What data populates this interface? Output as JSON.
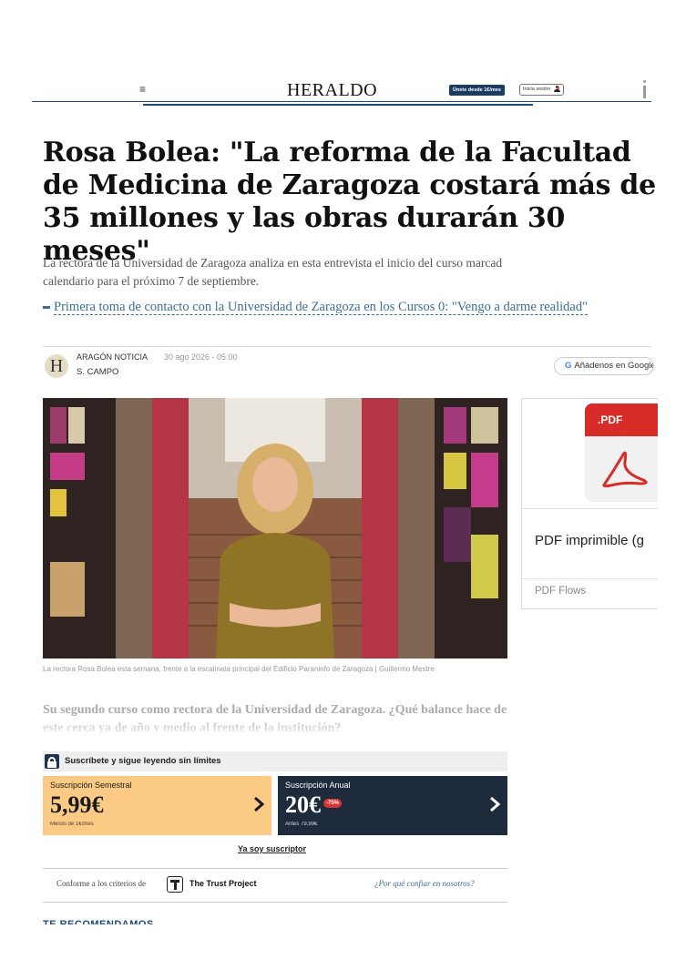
{
  "header": {
    "menu_icon": "hamburger-icon",
    "logo": "HERALDO",
    "join_button": "Únete desde 1€/mes",
    "login_button": "Inicia sesión",
    "login_icon": "user-icon"
  },
  "article": {
    "headline": "Rosa Bolea: \"La reforma de la Facultad de Medicina de Zaragoza costará más de 35 millones y las obras durarán 30 meses\"",
    "subtitle_line1": "La rectora de la Universidad de Zaragoza analiza en esta entrevista el inicio del curso marcad",
    "subtitle_line2": "calendario para el próximo 7 de septiembre.",
    "related_link": "Primera toma de contacto con la Universidad de Zaragoza en los Cursos 0: \"Vengo a darme realidad\"",
    "meta": {
      "avatar_letter": "H",
      "section": "ARAGÓN NOTICIA",
      "date": "30 ago 2026 - 05:00",
      "author": "S. CAMPO",
      "google_button": "Añádenos en Google"
    },
    "photo_caption": "La rectora Rosa Bolea esta semana, frente a la escalinata principal del Edificio Paraninfo de Zaragoza | Guillermo Mestre",
    "question": "Su segundo curso como rectora de la Universidad de Zaragoza. ¿Qué balance hace de este cerca ya de año y medio al frente de la institución?"
  },
  "ad": {
    "pdf_tag": ".PDF",
    "title": "PDF imprimible (g",
    "brand": "PDF Flows"
  },
  "paywall": {
    "title": "Suscríbete y sigue leyendo sin límites",
    "semestral": {
      "name": "Suscripción Semestral",
      "price": "5,99€",
      "note": "Menos de 1€/mes"
    },
    "anual": {
      "name": "Suscripción Anual",
      "price": "20€",
      "badge": "-75%",
      "note": "Antes 79,99€"
    },
    "subscriber_link": "Ya soy suscriptor"
  },
  "trust": {
    "label": "Conforme a los criterios de",
    "name": "The Trust Project",
    "why": "¿Por qué confiar en nosotros?"
  },
  "recommend_heading": "TE RECOMENDAMOS",
  "colors": {
    "brand_blue": "#1a4d7a",
    "link": "#3a6f93",
    "semestral_bg": "#fbcb85",
    "anual_bg": "#1d2b3c",
    "badge_red": "#d93434",
    "pdf_red": "#d72c28"
  }
}
